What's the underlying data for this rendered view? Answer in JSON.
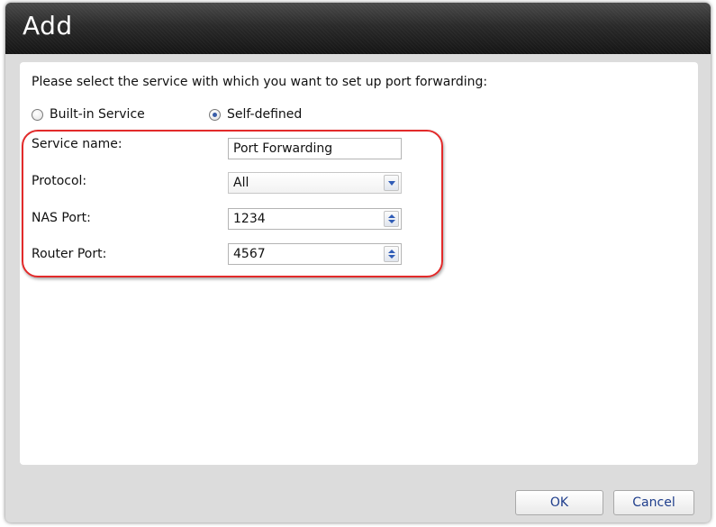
{
  "dialog": {
    "title": "Add"
  },
  "form": {
    "prompt": "Please select the service with which you want to set up port forwarding:",
    "service_options": [
      {
        "label": "Built-in Service",
        "selected": false
      },
      {
        "label": "Self-defined",
        "selected": true
      }
    ],
    "fields": {
      "service_name": {
        "label": "Service name:",
        "value": "Port Forwarding"
      },
      "protocol": {
        "label": "Protocol:",
        "value": "All"
      },
      "nas_port": {
        "label": "NAS Port:",
        "value": "1234"
      },
      "router_port": {
        "label": "Router Port:",
        "value": "4567"
      }
    }
  },
  "buttons": {
    "ok": "OK",
    "cancel": "Cancel"
  },
  "colors": {
    "title_bar": "#1f1f1f",
    "highlight": "#e22a2a",
    "button_text": "#1f3e8c",
    "spinner_arrow": "#2f5cb6"
  },
  "icons": {
    "dropdown": "chevron-down-icon",
    "spinner": "spinner-arrows-icon"
  }
}
